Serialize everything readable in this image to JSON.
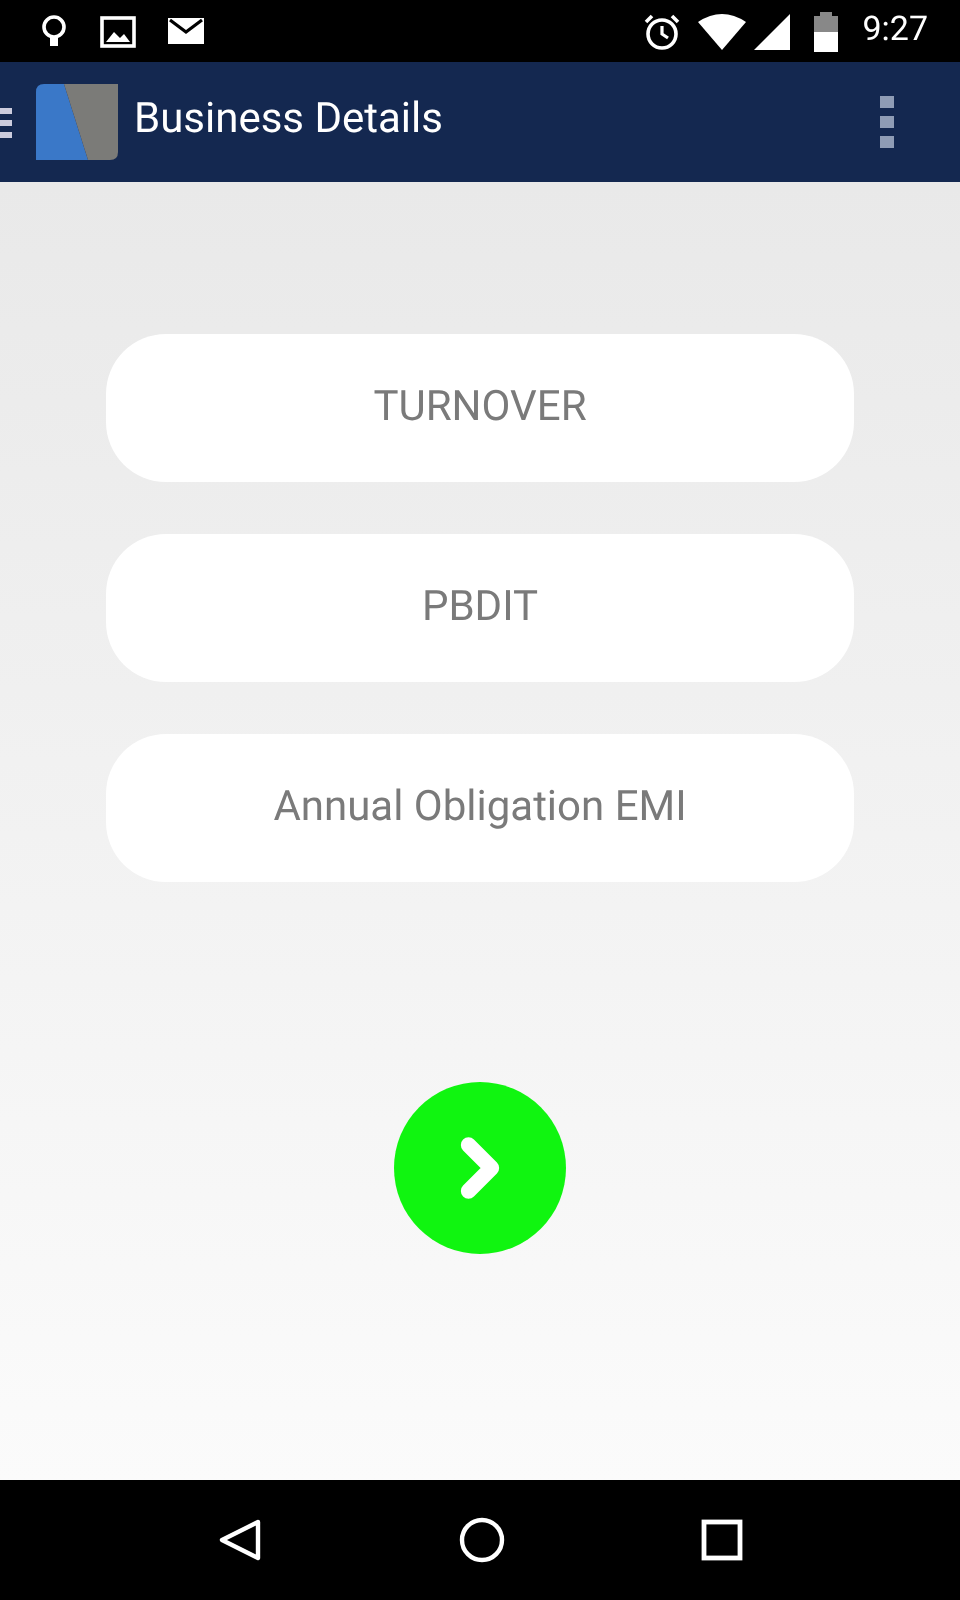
{
  "status_bar": {
    "time": "9:27"
  },
  "app_bar": {
    "title": "Business Details"
  },
  "fields": [
    {
      "placeholder": "TURNOVER"
    },
    {
      "placeholder": "PBDIT"
    },
    {
      "placeholder": "Annual Obligation EMI"
    }
  ]
}
